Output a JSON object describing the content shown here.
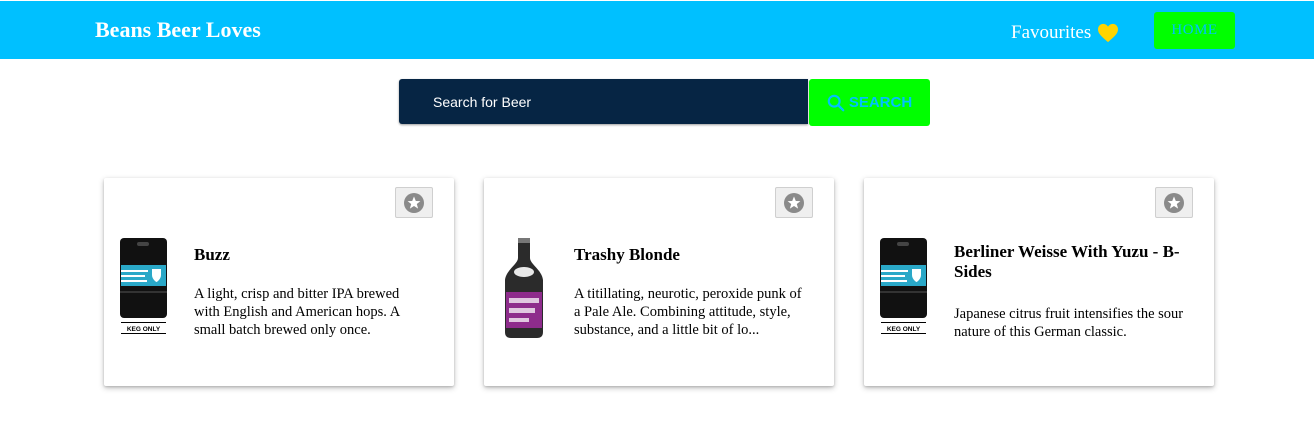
{
  "navbar": {
    "brand": "Beans Beer Loves",
    "favourites_label": "Favourites",
    "home_label": "HOME",
    "heart_color": "#ffd400"
  },
  "search": {
    "placeholder": "Search for Beer",
    "button_label": "SEARCH"
  },
  "colors": {
    "navbar": "#00c0ff",
    "accent_green": "#00ff00",
    "search_bg": "#062544"
  },
  "beers": [
    {
      "name": "Buzz",
      "description": "A light, crisp and bitter IPA brewed with English and American hops. A small batch brewed only once.",
      "image": "keg-icon",
      "image_text": "KEG ONLY"
    },
    {
      "name": "Trashy Blonde",
      "description": "A titillating, neurotic, peroxide punk of a Pale Ale. Combining attitude, style, substance, and a little bit of lo...",
      "image": "bottle-icon"
    },
    {
      "name": "Berliner Weisse With Yuzu - B-Sides",
      "description": "Japanese citrus fruit intensifies the sour nature of this German classic.",
      "image": "keg-icon",
      "image_text": "KEG ONLY"
    }
  ]
}
